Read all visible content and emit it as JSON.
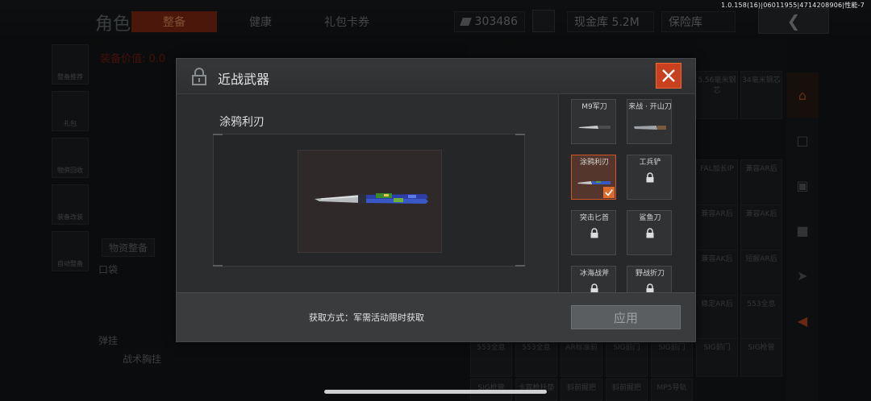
{
  "status": {
    "version": "1.0.158(16)|06011955|4714208906|性能-7"
  },
  "background": {
    "page_title": "角色",
    "tabs": [
      {
        "label": "整备",
        "active": true
      },
      {
        "label": "健康",
        "active": false
      },
      {
        "label": "礼包卡券",
        "active": false
      }
    ],
    "currency_value": "303486",
    "cash_vault_label": "现金库 5.2M",
    "safe_label": "保险库",
    "equip_value_label": "装备价值: 0.0",
    "sidebar_items": [
      "整备推荐",
      "礼包",
      "物资回收",
      "装备改装",
      "自动整备"
    ],
    "supply_button": "物资整备",
    "pocket_label": "口袋",
    "hang_label": "弹挂",
    "vest_label": "战术胸挂",
    "grid_cells": [
      "5.56毫米钢芯",
      "34毫米钢芯",
      "FAL加长IP",
      "兼容AR后",
      "兼容AR后",
      "兼容AK后",
      "兼容AK后",
      "短握AR后",
      "稳定AR后",
      "553全息",
      "553全息",
      "553全息",
      "AR标准前",
      "SIG前门",
      "SIG前门",
      "SIG前门",
      "SIG枪管",
      "SIG枪管",
      "卡宾枪托垫",
      "斜前握把",
      "斜前握把",
      "MP5导轨"
    ]
  },
  "modal": {
    "title": "近战武器",
    "selected_weapon_name": "涂鸦利刃",
    "acquire_text": "获取方式：军需活动限时获取",
    "apply_label": "应用",
    "weapons": [
      {
        "name": "M9军刀",
        "locked": false,
        "selected": false
      },
      {
        "name": "来战 · 开山刀",
        "locked": false,
        "selected": false
      },
      {
        "name": "涂鸦利刃",
        "locked": false,
        "selected": true
      },
      {
        "name": "工兵铲",
        "locked": true,
        "selected": false
      },
      {
        "name": "突击匕首",
        "locked": true,
        "selected": false
      },
      {
        "name": "鲨鱼刀",
        "locked": true,
        "selected": false
      },
      {
        "name": "冰海战斧",
        "locked": true,
        "selected": false
      },
      {
        "name": "野战折刀",
        "locked": true,
        "selected": false
      }
    ]
  },
  "colors": {
    "accent": "#c9401f",
    "selected_border": "#d0542a"
  }
}
